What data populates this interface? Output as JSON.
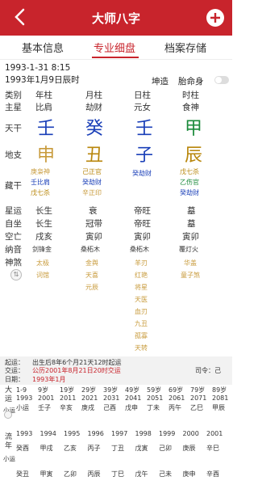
{
  "header": {
    "title": "大师八字",
    "back_icon": "chevron-left-icon",
    "add_icon": "plus-circle-icon"
  },
  "tabs": [
    {
      "label": "基本信息"
    },
    {
      "label": "专业细盘"
    },
    {
      "label": "档案存储"
    }
  ],
  "info": {
    "solar": "1993-1-31 8:15",
    "lunar": "1993年1月9日辰时",
    "gender": "坤造",
    "fetal_label": "胎命身"
  },
  "columns": [
    "年柱",
    "月柱",
    "日柱",
    "时柱"
  ],
  "rows": {
    "category_label": "类别",
    "main_star_label": "主星",
    "main_star": [
      "比肩",
      "劫财",
      "元女",
      "食神"
    ],
    "stem_label": "天干",
    "stems": [
      "壬",
      "癸",
      "壬",
      "甲"
    ],
    "branch_label": "地支",
    "branches": [
      "申",
      "丑",
      "子",
      "辰"
    ],
    "hidden_label": "藏干",
    "hidden": [
      [
        "庚枭神",
        "壬比肩",
        "戊七杀"
      ],
      [
        "己正官",
        "癸劫财",
        "辛正印"
      ],
      [
        "癸劫财"
      ],
      [
        "戊七杀",
        "乙伤官",
        "癸劫财"
      ]
    ],
    "star_luck_label": "星运",
    "star_luck": [
      "长生",
      "衰",
      "帝旺",
      "墓"
    ],
    "self_seat_label": "自坐",
    "self_seat": [
      "长生",
      "冠带",
      "帝旺",
      "墓"
    ],
    "void_label": "空亡",
    "void": [
      "戌亥",
      "寅卯",
      "寅卯",
      "寅卯"
    ],
    "nayin_label": "纳音",
    "nayin": [
      "剑锋金",
      "桑柘木",
      "桑柘木",
      "覆灯火"
    ],
    "shensha_label": "神煞",
    "shensha": [
      [
        "太极",
        "词馆"
      ],
      [
        "金舆",
        "天喜",
        "元辰"
      ],
      [
        "羊刃",
        "红艳",
        "将星",
        "天医",
        "血刃",
        "九丑",
        "孤寡",
        "天转"
      ],
      [
        "华盖",
        "童子煞"
      ]
    ]
  },
  "qiyun": {
    "label1": "起运：",
    "value1": "出生后8年6个月21天12时起运",
    "label2": "交运：",
    "value2": "公历2001年8月21日20时交运",
    "siling": "司令：己",
    "label3": "日期：",
    "value3": "1993年1月"
  },
  "dayun": {
    "side_label": "大运",
    "xiao_label": "小运",
    "ages": [
      "1-9",
      "9岁",
      "19岁",
      "29岁",
      "39岁",
      "49岁",
      "59岁",
      "69岁",
      "79岁",
      "89岁"
    ],
    "years": [
      "1993",
      "2001",
      "2011",
      "2021",
      "2031",
      "2041",
      "2051",
      "2061",
      "2071",
      "2081"
    ],
    "pillars": [
      "小运",
      "壬子",
      "辛亥",
      "庚戌",
      "己酉",
      "戊申",
      "丁未",
      "丙午",
      "乙巳",
      "甲辰"
    ]
  },
  "liunian": {
    "side_label": "流年",
    "xiao_label": "小运",
    "years": [
      "1993",
      "1994",
      "1995",
      "1996",
      "1997",
      "1998",
      "1999",
      "2000",
      "2001"
    ],
    "pillars": [
      "癸酉",
      "甲戌",
      "乙亥",
      "丙子",
      "丁丑",
      "戊寅",
      "己卯",
      "庚辰",
      "辛巳"
    ],
    "row2": [
      "癸丑",
      "甲寅",
      "乙卯",
      "丙辰",
      "丁巳",
      "戊午",
      "己未",
      "庚申",
      "辛酉"
    ]
  }
}
